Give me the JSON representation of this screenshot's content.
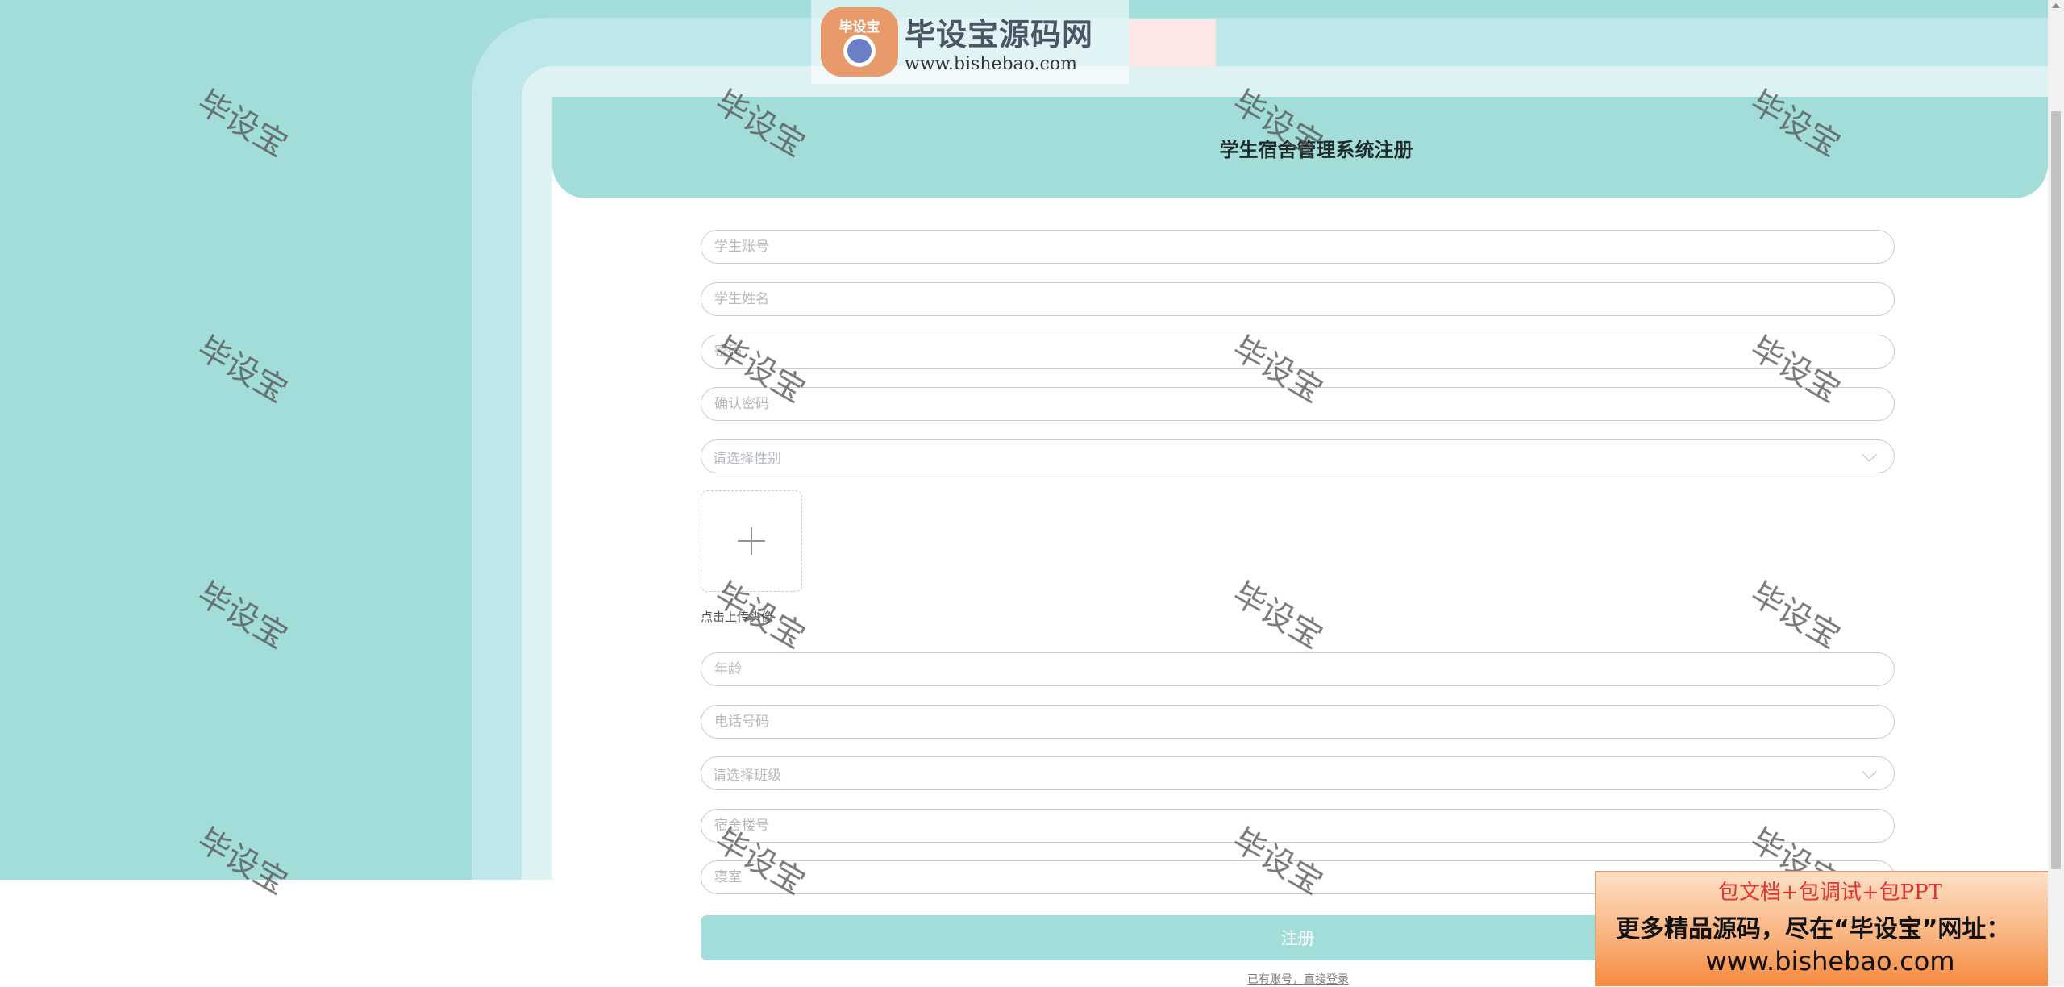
{
  "page": {
    "title": "学生宿舍管理系统注册"
  },
  "form": {
    "account_placeholder": "学生账号",
    "name_placeholder": "学生姓名",
    "password_placeholder": "密码",
    "confirm_password_placeholder": "确认密码",
    "gender_select": "请选择性别",
    "upload_label": "点击上传头像",
    "age_placeholder": "年龄",
    "phone_placeholder": "电话号码",
    "class_select": "请选择班级",
    "building_placeholder": "宿舍楼号",
    "room_placeholder": "寝室",
    "submit_label": "注册",
    "login_link": "已有账号，直接登录"
  },
  "logo": {
    "badge": "毕设宝",
    "title": "毕设宝源码网",
    "url": "www.bishebao.com"
  },
  "watermark": {
    "text": "毕设宝"
  },
  "ad": {
    "line1": "包文档+包调试+包PPT",
    "line2": "更多精品源码，尽在“毕设宝”网址：",
    "line3": "www.bishebao.com"
  },
  "colors": {
    "accent": "#a3ddda",
    "ring": "#bde7e9",
    "inner_ring": "#dff2f3"
  }
}
